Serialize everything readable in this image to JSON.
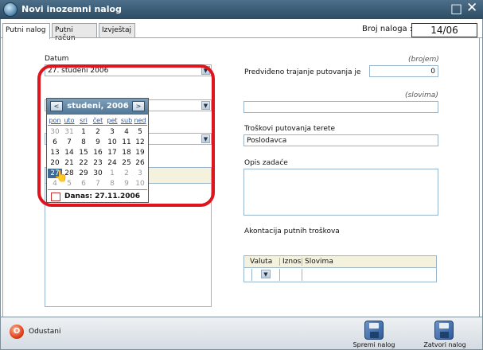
{
  "window": {
    "title": "Novi inozemni nalog"
  },
  "tabs": [
    {
      "label": "Putni nalog"
    },
    {
      "label": "Putni račun"
    },
    {
      "label": "Izvještaj"
    }
  ],
  "broj_naloga": {
    "label": "Broj naloga :",
    "value": "14/06"
  },
  "left": {
    "datum_label": "Datum",
    "datum_value": "27. studeni 2006"
  },
  "calendar": {
    "month_label": "studeni, 2006",
    "prev": "<",
    "next": ">",
    "weekdays": [
      "pon",
      "uto",
      "sri",
      "čet",
      "pet",
      "sub",
      "ned"
    ],
    "weeks": [
      [
        "30",
        "31",
        "1",
        "2",
        "3",
        "4",
        "5"
      ],
      [
        "6",
        "7",
        "8",
        "9",
        "10",
        "11",
        "12"
      ],
      [
        "13",
        "14",
        "15",
        "16",
        "17",
        "18",
        "19"
      ],
      [
        "20",
        "21",
        "22",
        "23",
        "24",
        "25",
        "26"
      ],
      [
        "27",
        "28",
        "29",
        "30",
        "1",
        "2",
        "3"
      ],
      [
        "4",
        "5",
        "6",
        "7",
        "8",
        "9",
        "10"
      ]
    ],
    "today_label": "Danas: 27.11.2006"
  },
  "right": {
    "trajanje_hint": "(brojem)",
    "trajanje_label": "Predviđeno trajanje putovanja je",
    "trajanje_value": "0",
    "slovima_hint": "(slovima)",
    "slovima_value": "",
    "troskovi_label": "Troškovi putovanja terete",
    "troskovi_value": "Poslodavca",
    "opis_label": "Opis zadaće",
    "akontacija_label": "Akontacija putnih troškova",
    "akontacija_columns": [
      "Valuta",
      "Iznos",
      "Slovima"
    ]
  },
  "footer": {
    "odustani_icon": "O",
    "odustani": "Odustani",
    "spremi": "Spremi nalog",
    "zatvori": "Zatvori nalog"
  }
}
